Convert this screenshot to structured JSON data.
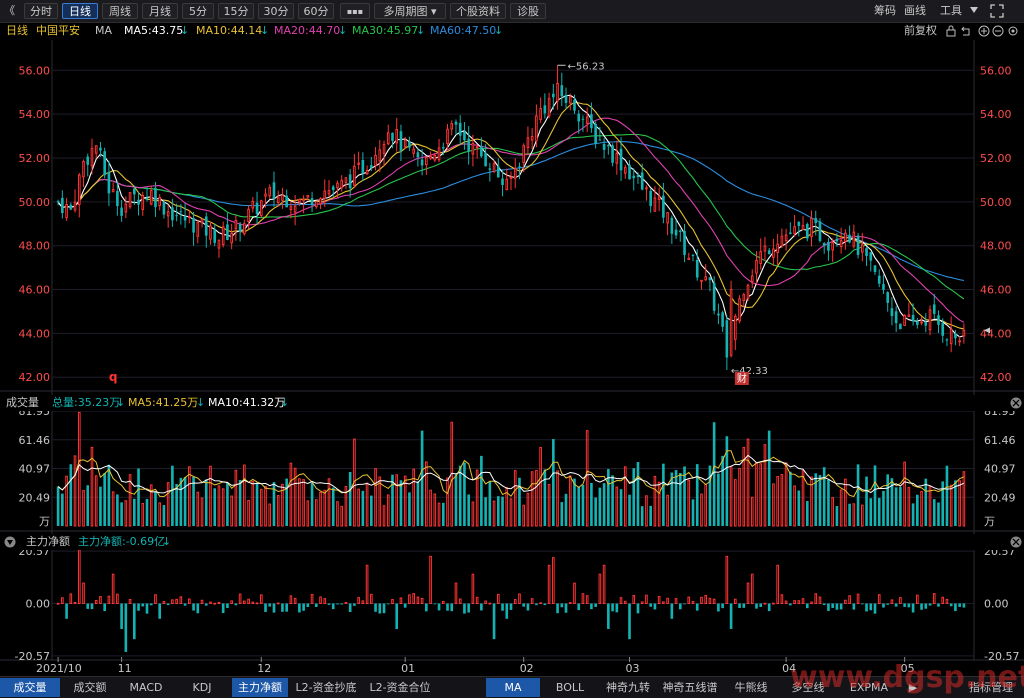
{
  "toolbar": {
    "back_label": "《",
    "periods": [
      "分时",
      "日线",
      "周线",
      "月线",
      "5分",
      "15分",
      "30分",
      "60分"
    ],
    "active_period": "日线",
    "more_label": "▪▪▪",
    "multi_period_label": "多周期图 ▾",
    "stock_info_label": "个股资料",
    "diagnose_label": "诊股",
    "chips_label": "筹码",
    "draw_label": "画线",
    "tools_label": "工具",
    "tools_icon": "chevron-down-icon",
    "expand_icon": "expand-icon"
  },
  "legend": {
    "period": "日线",
    "stock_name": "中国平安",
    "ma_label": "MA",
    "ma5": "MA5:43.75",
    "ma10": "MA10:44.14",
    "ma20": "MA20:44.70",
    "ma30": "MA30:45.97",
    "ma60": "MA60:47.50",
    "adjust_label": "前复权",
    "arrow_down": "↓"
  },
  "colors": {
    "up": "#ff3333",
    "down": "#14b2b2",
    "ma5": "#ffffff",
    "ma10": "#e8c230",
    "ma20": "#e040b0",
    "ma30": "#27c34a",
    "ma60": "#2a8de0",
    "grid": "#1e1e2a",
    "axis_text": "#ff4d4d"
  },
  "volume_panel": {
    "title": "成交量",
    "total": "总量:35.23万",
    "ma5": "MA5:41.25万",
    "ma10": "MA10:41.32万",
    "arrow": "↓",
    "unit": "万"
  },
  "fund_panel": {
    "title": "主力净额",
    "value": "主力净额:-0.69亿",
    "arrow": "↓"
  },
  "tabs_left": [
    "成交量",
    "成交额",
    "MACD",
    "KDJ",
    "主力净额",
    "L2-资金抄底",
    "L2-资金合位"
  ],
  "tabs_right": [
    "MA",
    "BOLL",
    "神奇九转",
    "神奇五线谱",
    "牛熊线",
    "多空线",
    "EXPMA"
  ],
  "active_left_tab": "成交量",
  "active_right_tab": "MA",
  "next_label": "▶",
  "indicator_manage": "指标管理",
  "watermark": "www.dgsp.net",
  "chart_data": {
    "type": "candlestick",
    "price_axis": {
      "ticks": [
        "56.00",
        "54.00",
        "52.00",
        "50.00",
        "48.00",
        "46.00",
        "44.00",
        "42.00"
      ],
      "ylim": [
        41.6,
        57.2
      ]
    },
    "volume_axis": {
      "ticks": [
        "81.95",
        "61.46",
        "40.97",
        "20.49"
      ],
      "unit": "万",
      "ylim": [
        0,
        82
      ]
    },
    "fund_axis": {
      "ticks": [
        "20.57",
        "0.00",
        "-20.57"
      ]
    },
    "x_labels": [
      "2021/10",
      "11",
      "12",
      "01",
      "02",
      "03",
      "04",
      "05"
    ],
    "x_label_index": [
      0,
      15,
      48,
      82,
      110,
      135,
      172,
      200
    ],
    "annotations": {
      "high": "56.23",
      "high_index": 118,
      "low": "42.33",
      "low_index": 158,
      "low_marker": "财",
      "q_marker": "q"
    },
    "ohlc": [],
    "volume": [],
    "fund": []
  }
}
